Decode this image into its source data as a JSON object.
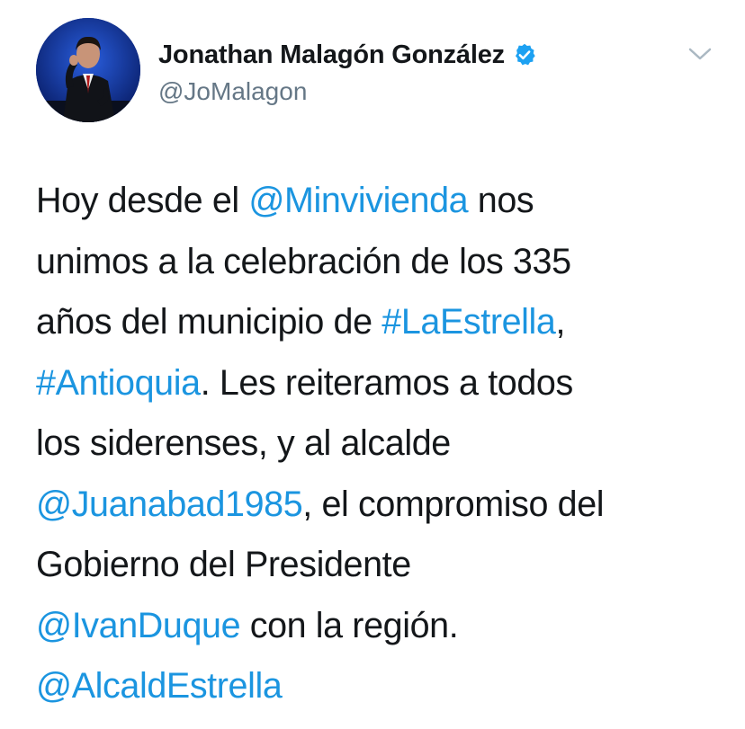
{
  "author": {
    "display_name": "Jonathan Malagón González",
    "handle": "@JoMalagon",
    "verified": true
  },
  "icons": {
    "verified": "verified-badge-icon",
    "menu": "chevron-down-icon",
    "avatar": "profile-photo"
  },
  "colors": {
    "link": "#1b95e0",
    "text": "#14171a",
    "secondary": "#657786",
    "verified": "#1da1f2"
  },
  "tweet": {
    "l1": {
      "a": "Hoy desde el ",
      "b": "@Minvivienda",
      "c": " nos"
    },
    "l2": {
      "a": "unimos a la celebración de los 335"
    },
    "l3": {
      "a": "años del municipio de ",
      "b": "#LaEstrella",
      "c": ","
    },
    "l4": {
      "b": "#Antioquia",
      "c": ". Les reiteramos a todos"
    },
    "l5": {
      "a": "los siderenses, y al alcalde"
    },
    "l6": {
      "b": "@Juanabad1985",
      "c": ", el compromiso del"
    },
    "l7": {
      "a": "Gobierno del Presidente"
    },
    "l8": {
      "b": "@IvanDuque",
      "c": " con la región."
    },
    "l9": {
      "b": "@AlcaldEstrella"
    }
  }
}
